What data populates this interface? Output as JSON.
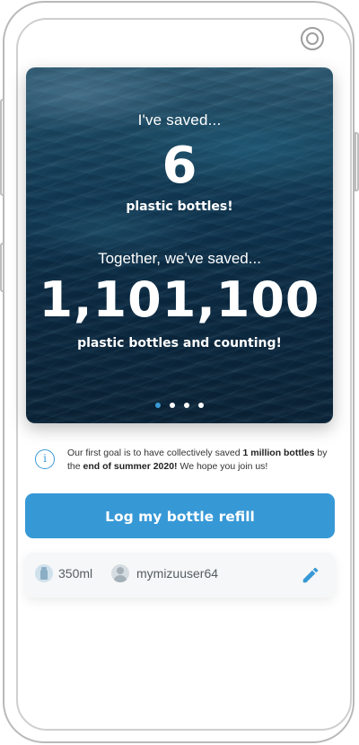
{
  "hero": {
    "personal_label": "I've saved...",
    "personal_count": "6",
    "personal_unit": "plastic bottles!",
    "together_label": "Together, we've saved...",
    "together_count": "1,101,100",
    "together_unit": "plastic bottles and counting!",
    "carousel": {
      "total_pages": 4,
      "active_page": 1
    }
  },
  "info": {
    "icon": "info-icon",
    "part1": "Our first goal is to have collectively saved ",
    "bold1": "1 million bottles",
    "part2": " by the ",
    "bold2": "end of summer 2020!",
    "part3": " We hope you join us!"
  },
  "actions": {
    "log_refill_label": "Log my bottle refill"
  },
  "footer": {
    "bottle_size": "350ml",
    "username": "mymizuuser64",
    "bottle_icon": "bottle-icon",
    "user_icon": "user-avatar-icon",
    "edit_icon": "pencil-icon"
  },
  "colors": {
    "accent": "#3798d6",
    "active_dot": "#3b9ad6",
    "ocean_dark": "#0a2236"
  }
}
